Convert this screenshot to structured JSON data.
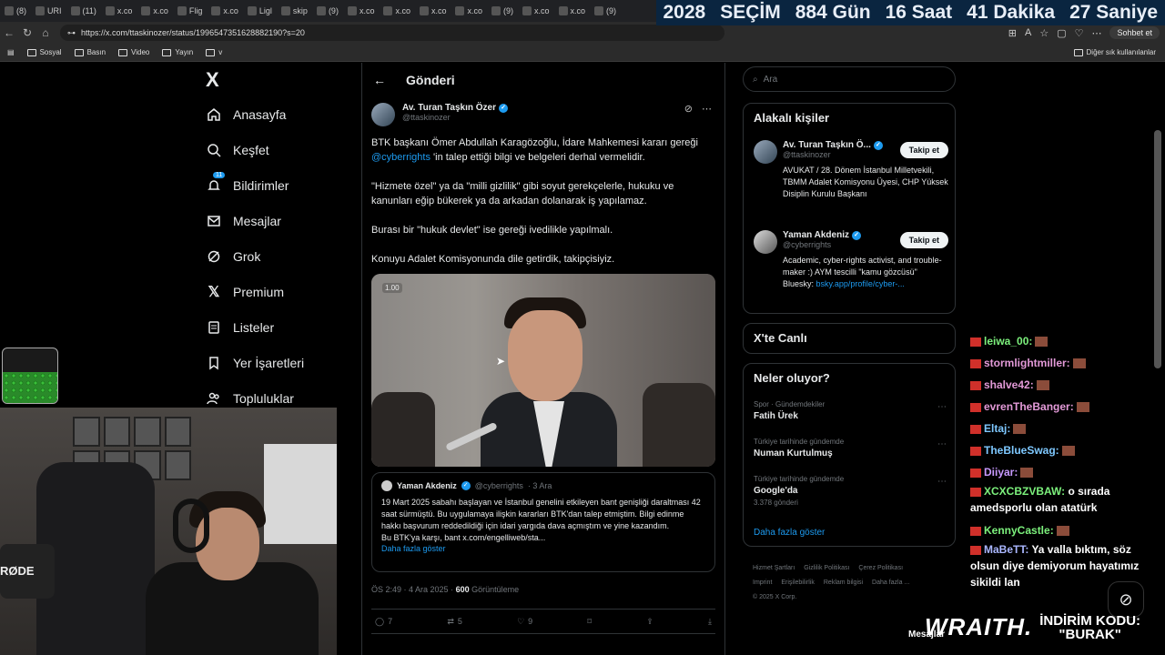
{
  "browser": {
    "tabs": [
      "(8)",
      "URI",
      "(11)",
      "x.co",
      "x.co",
      "Flig",
      "x.co",
      "Ligl",
      "skip",
      "(9)",
      "x.co",
      "x.co",
      "x.co",
      "x.co",
      "(9)",
      "x.co",
      "x.co",
      "(9)"
    ],
    "url": "https://x.com/ttaskinozer/status/1996547351628882190?s=20",
    "copilot_label": "Sohbet et",
    "bookmarks": [
      "Sosyal",
      "Basın",
      "Video",
      "Yayın",
      "v"
    ],
    "bookmarks_right": "Diğer sık kullanılanlar"
  },
  "countdown": {
    "year": "2028",
    "label": "SEÇİM",
    "days": "884 Gün",
    "hours": "16 Saat",
    "minutes": "41 Dakika",
    "seconds": "27 Saniye"
  },
  "sidebar": {
    "logo": "X",
    "notifications_badge": "11",
    "items": [
      {
        "label": "Anasayfa",
        "icon": "home-icon"
      },
      {
        "label": "Keşfet",
        "icon": "search-icon"
      },
      {
        "label": "Bildirimler",
        "icon": "bell-icon"
      },
      {
        "label": "Mesajlar",
        "icon": "mail-icon"
      },
      {
        "label": "Grok",
        "icon": "grok-icon"
      },
      {
        "label": "Premium",
        "icon": "x-icon"
      },
      {
        "label": "Listeler",
        "icon": "list-icon"
      },
      {
        "label": "Yer İşaretleri",
        "icon": "bookmark-icon"
      },
      {
        "label": "Topluluklar",
        "icon": "people-icon"
      }
    ]
  },
  "post": {
    "header_title": "Gönderi",
    "author_name": "Av. Turan Taşkın Özer",
    "author_handle": "@ttaskinozer",
    "text_1a": "BTK başkanı Ömer Abdullah Karagözoğlu, İdare Mahkemesi kararı gereği",
    "mention": "@cyberrights",
    "text_1b": " 'in talep ettiği bilgi ve belgeleri derhal vermelidir.",
    "text_2": "\"Hizmete özel\" ya da \"milli gizlilik\" gibi soyut gerekçelerle, hukuku ve kanunları eğip bükerek ya da arkadan dolanarak iş yapılamaz.",
    "text_3": "Burası bir \"hukuk devlet\" ise gereği ivedilikle yapılmalı.",
    "text_4": "Konuyu Adalet Komisyonunda dile getirdik, takipçisiyiz.",
    "video_tag": "1.00",
    "quote": {
      "author": "Yaman Akdeniz",
      "handle": "@cyberrights",
      "date": "· 3 Ara",
      "text": "19 Mart 2025 sabahı başlayan ve İstanbul genelini etkileyen bant genişliği daraltması 42 saat sürmüştü. Bu uygulamaya ilişkin kararları BTK'dan talep etmiştim. Bilgi edinme hakkı başvurum reddedildiği için idari yargıda dava açmıştım ve yine kazandım.",
      "text_2": "Bu BTK'ya karşı, bant x.com/engelliweb/sta...",
      "show_more": "Daha fazla göster"
    },
    "time": "ÖS 2:49 · 4 Ara 2025 · ",
    "views": "600",
    "views_label": " Görüntüleme",
    "replies": "7",
    "reposts": "5",
    "likes": "9"
  },
  "right": {
    "search_placeholder": "Ara",
    "related_title": "Alakalı kişiler",
    "people": [
      {
        "name": "Av. Turan Taşkın Ö...",
        "handle": "@ttaskinozer",
        "bio": "AVUKAT / 28. Dönem İstanbul Milletvekili, TBMM Adalet Komisyonu Üyesi, CHP Yüksek Disiplin Kurulu Başkanı",
        "follow": "Takip et"
      },
      {
        "name": "Yaman Akdeniz",
        "handle": "@cyberrights",
        "bio": "Academic, cyber-rights activist, and trouble-maker :) AYM tescilli \"kamu gözcüsü\" Bluesky:",
        "link": "bsky.app/profile/cyber-...",
        "follow": "Takip et"
      }
    ],
    "live_title": "X'te Canlı",
    "trends_title": "Neler oluyor?",
    "trends": [
      {
        "category": "Spor · Gündemdekiler",
        "name": "Fatih Ürek",
        "count": ""
      },
      {
        "category": "Türkiye tarihinde gündemde",
        "name": "Numan Kurtulmuş",
        "count": ""
      },
      {
        "category": "Türkiye tarihinde gündemde",
        "name": "Google'da",
        "count": "3.378 gönderi"
      }
    ],
    "show_more": "Daha fazla göster",
    "footer": [
      "Hizmet Şartları",
      "Gizlilik Politikası",
      "Çerez Politikası",
      "Imprint",
      "Erişilebilirlik",
      "Reklam bilgisi",
      "Daha fazla ...",
      "© 2025 X Corp."
    ]
  },
  "chat": [
    {
      "user": "leiwa_00:",
      "msg": "",
      "color": "#7cf07c"
    },
    {
      "user": "stormlightmiller:",
      "msg": "",
      "color": "#e39ad8"
    },
    {
      "user": "shalve42:",
      "msg": "",
      "color": "#e39ad8"
    },
    {
      "user": "evrenTheBanger:",
      "msg": "",
      "color": "#e39ad8"
    },
    {
      "user": "Eltaj:",
      "msg": "",
      "color": "#7ec8ff"
    },
    {
      "user": "TheBlueSwag:",
      "msg": "",
      "color": "#7ec8ff"
    },
    {
      "user": "Diiyar:",
      "msg": "",
      "color": "#c89aff"
    },
    {
      "user": "XCXCBZVBAW:",
      "msg": " o sırada amedsporlu olan atatürk",
      "color": "#7cf07c"
    },
    {
      "user": "KennyCastle:",
      "msg": "",
      "color": "#7cf07c"
    },
    {
      "user": "MaBeTT:",
      "msg": " Ya valla bıktım, söz olsun diye demiyorum hayatımız sikildi lan",
      "color": "#aab7ff"
    }
  ],
  "overlay": {
    "brand": "WRAITH.",
    "promo_label": "İNDİRİM KODU:",
    "promo_code": "\"BURAK\"",
    "mic_brand": "RØDE",
    "messages_label": "Mesajlar"
  }
}
